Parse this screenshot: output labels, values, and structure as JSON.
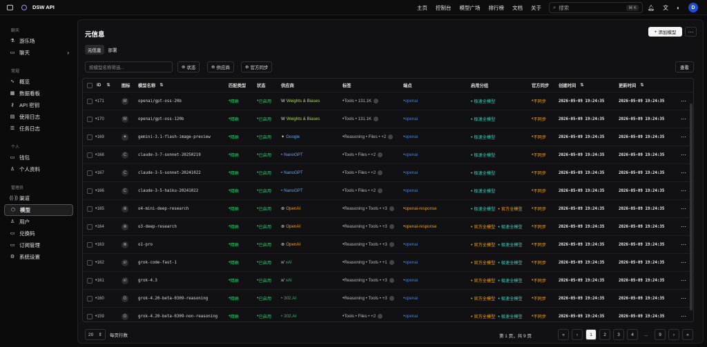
{
  "app": {
    "name": "DSW API"
  },
  "nav": [
    "主页",
    "控制台",
    "模型广场",
    "排行榜",
    "文档",
    "关于"
  ],
  "search": {
    "placeholder": "搜索",
    "shortcut": "⌘ K"
  },
  "user": {
    "initial": "D"
  },
  "sidebar": {
    "sections": [
      {
        "title": "聊天",
        "items": [
          {
            "label": "游乐场",
            "icon": "flask-icon"
          },
          {
            "label": "聊天",
            "icon": "chat-icon",
            "chevron": true
          }
        ]
      },
      {
        "title": "常规",
        "items": [
          {
            "label": "概览",
            "icon": "activity-icon"
          },
          {
            "label": "数据看板",
            "icon": "dashboard-icon"
          },
          {
            "label": "API 密钥",
            "icon": "key-icon"
          },
          {
            "label": "使用日志",
            "icon": "log-icon"
          },
          {
            "label": "任务日志",
            "icon": "task-icon"
          }
        ]
      },
      {
        "title": "个人",
        "items": [
          {
            "label": "钱包",
            "icon": "wallet-icon"
          },
          {
            "label": "个人资料",
            "icon": "user-icon"
          }
        ]
      },
      {
        "title": "管理员",
        "items": [
          {
            "label": "渠道",
            "icon": "channel-icon"
          },
          {
            "label": "模型",
            "icon": "cube-icon",
            "active": true
          },
          {
            "label": "用户",
            "icon": "users-icon"
          },
          {
            "label": "兑换码",
            "icon": "ticket-icon"
          },
          {
            "label": "订阅管理",
            "icon": "subscription-icon"
          },
          {
            "label": "系统设置",
            "icon": "settings-icon"
          }
        ]
      }
    ]
  },
  "page": {
    "title": "元信息",
    "add_label": "添加模型",
    "tabs": [
      "元信息",
      "部署"
    ],
    "filter_placeholder": "按模型名称筛选...",
    "filters": [
      "状态",
      "供应商",
      "官方同步"
    ],
    "query_label": "查看"
  },
  "table": {
    "headers": [
      "ID",
      "图标",
      "模型名称",
      "匹配类型",
      "状态",
      "供应商",
      "标签",
      "端点",
      "启用分组",
      "官方同步",
      "创建时间",
      "更新时间"
    ],
    "rows": [
      {
        "id": "171",
        "icon": "W",
        "name": "openai/gpt-oss-20b",
        "match": "精确",
        "status": "已启用",
        "vendor": "Weights & Biases",
        "vendor_color": "#a3e635",
        "vendor_icon": "W",
        "tags": "Tools • 131.1K",
        "tag_pre": "",
        "endpoint": "openai",
        "ep_color": "#3b82f6",
        "groups": [
          "极速全模型"
        ],
        "sync": "不同步",
        "created": "2026-05-09 19:24:35",
        "updated": "2026-05-09 19:24:35"
      },
      {
        "id": "170",
        "icon": "W",
        "name": "openai/gpt-oss-120b",
        "match": "精确",
        "status": "已启用",
        "vendor": "Weights & Biases",
        "vendor_color": "#a3e635",
        "vendor_icon": "W",
        "tags": "Tools • 131.1K",
        "tag_pre": "",
        "endpoint": "openai",
        "ep_color": "#3b82f6",
        "groups": [
          "极速全模型"
        ],
        "sync": "不同步",
        "created": "2026-05-09 19:24:35",
        "updated": "2026-05-09 19:24:35"
      },
      {
        "id": "169",
        "icon": "✦",
        "name": "gemini-3.1-flash-image-preview",
        "match": "精确",
        "status": "已启用",
        "vendor": "Google",
        "vendor_color": "#60a5fa",
        "vendor_icon": "✦",
        "tags": "Reasoning • Files • +2",
        "endpoint": "openai",
        "ep_color": "#3b82f6",
        "groups": [
          "极速全模型"
        ],
        "sync": "不同步",
        "created": "2026-05-09 19:24:35",
        "updated": "2026-05-09 19:24:35"
      },
      {
        "id": "168",
        "icon": "C",
        "name": "claude-3-7-sonnet-20250219",
        "match": "精确",
        "status": "已启用",
        "vendor": "NanoGPT",
        "vendor_color": "#60a5fa",
        "vendor_icon": "",
        "tags": "Tools • Files • +2",
        "endpoint": "openai",
        "ep_color": "#3b82f6",
        "groups": [
          "极速全模型"
        ],
        "sync": "不同步",
        "created": "2026-05-09 19:24:35",
        "updated": "2026-05-09 19:24:35"
      },
      {
        "id": "167",
        "icon": "C",
        "name": "claude-3-5-sonnet-20241022",
        "match": "精确",
        "status": "已启用",
        "vendor": "NanoGPT",
        "vendor_color": "#60a5fa",
        "vendor_icon": "",
        "tags": "Tools • Files • +2",
        "endpoint": "openai",
        "ep_color": "#3b82f6",
        "groups": [
          "极速全模型"
        ],
        "sync": "不同步",
        "created": "2026-05-09 19:24:35",
        "updated": "2026-05-09 19:24:35"
      },
      {
        "id": "166",
        "icon": "C",
        "name": "claude-3-5-haiku-20241022",
        "match": "精确",
        "status": "已启用",
        "vendor": "NanoGPT",
        "vendor_color": "#60a5fa",
        "vendor_icon": "",
        "tags": "Tools • Files • +2",
        "endpoint": "openai",
        "ep_color": "#3b82f6",
        "groups": [
          "极速全模型"
        ],
        "sync": "不同步",
        "created": "2026-05-09 19:24:35",
        "updated": "2026-05-09 19:24:35"
      },
      {
        "id": "165",
        "icon": "⊛",
        "name": "o4-mini-deep-research",
        "match": "精确",
        "status": "已启用",
        "vendor": "OpenAI",
        "vendor_color": "#f59e0b",
        "vendor_icon": "⊛",
        "tags": "Reasoning • Tools • +3",
        "endpoint": "openai-response",
        "ep_color": "#f59e0b",
        "groups": [
          "极速全模型",
          "官方全模型"
        ],
        "sync": "不同步",
        "created": "2026-05-09 19:24:35",
        "updated": "2026-05-09 19:24:35"
      },
      {
        "id": "164",
        "icon": "⊛",
        "name": "o3-deep-research",
        "match": "精确",
        "status": "已启用",
        "vendor": "OpenAI",
        "vendor_color": "#f59e0b",
        "vendor_icon": "⊛",
        "tags": "Reasoning • Tools • +3",
        "endpoint": "openai-response",
        "ep_color": "#f59e0b",
        "groups": [
          "官方全模型",
          "极速全模型"
        ],
        "sync": "不同步",
        "created": "2026-05-09 19:24:35",
        "updated": "2026-05-09 19:24:35"
      },
      {
        "id": "163",
        "icon": "⊛",
        "name": "o1-pro",
        "match": "精确",
        "status": "已启用",
        "vendor": "OpenAI",
        "vendor_color": "#f59e0b",
        "vendor_icon": "⊛",
        "tags": "Reasoning • Tools • +3",
        "endpoint": "openai",
        "ep_color": "#3b82f6",
        "groups": [
          "官方全模型",
          "极速全模型"
        ],
        "sync": "不同步",
        "created": "2026-05-09 19:24:35",
        "updated": "2026-05-09 19:24:35"
      },
      {
        "id": "162",
        "icon": "x/",
        "name": "grok-code-fast-1",
        "match": "精确",
        "status": "已启用",
        "vendor": "xAI",
        "vendor_color": "#22c55e",
        "vendor_icon": "x/",
        "tags": "Reasoning • Tools • +1",
        "endpoint": "openai",
        "ep_color": "#3b82f6",
        "groups": [
          "官方全模型",
          "极速全模型"
        ],
        "sync": "不同步",
        "created": "2026-05-09 19:24:35",
        "updated": "2026-05-09 19:24:35"
      },
      {
        "id": "161",
        "icon": "x/",
        "name": "grok-4.3",
        "match": "精确",
        "status": "已启用",
        "vendor": "xAI",
        "vendor_color": "#22c55e",
        "vendor_icon": "x/",
        "tags": "Reasoning • Tools • +3",
        "endpoint": "openai",
        "ep_color": "#3b82f6",
        "groups": [
          "官方全模型",
          "极速全模型"
        ],
        "sync": "不同步",
        "created": "2026-05-09 19:24:35",
        "updated": "2026-05-09 19:24:35"
      },
      {
        "id": "160",
        "icon": "G",
        "name": "grok-4.20-beta-0309-reasoning",
        "match": "精确",
        "status": "已启用",
        "vendor": "302.AI",
        "vendor_color": "#22c55e",
        "vendor_icon": "",
        "tags": "Reasoning • Tools • +3",
        "endpoint": "openai",
        "ep_color": "#3b82f6",
        "groups": [
          "官方全模型",
          "极速全模型"
        ],
        "sync": "不同步",
        "created": "2026-05-09 19:24:35",
        "updated": "2026-05-09 19:24:35"
      },
      {
        "id": "159",
        "icon": "G",
        "name": "grok-4.20-beta-0309-non-reasoning",
        "match": "精确",
        "status": "已启用",
        "vendor": "302.AI",
        "vendor_color": "#22c55e",
        "vendor_icon": "",
        "tags": "Tools • Files • +2",
        "endpoint": "openai",
        "ep_color": "#3b82f6",
        "groups": [
          "官方全模型",
          "极速全模型"
        ],
        "sync": "不同步",
        "created": "2026-05-09 19:24:35",
        "updated": "2026-05-09 19:24:35"
      }
    ]
  },
  "pagination": {
    "page_size": "20",
    "page_size_label": "每页行数",
    "info": "第 1 页，共 9 页",
    "pages": [
      "1",
      "2",
      "3",
      "4",
      "...",
      "9"
    ]
  },
  "colors": {
    "green": "#22c55e",
    "blue": "#3b82f6",
    "orange": "#f59e0b",
    "group_green": "#2dd4bf"
  }
}
